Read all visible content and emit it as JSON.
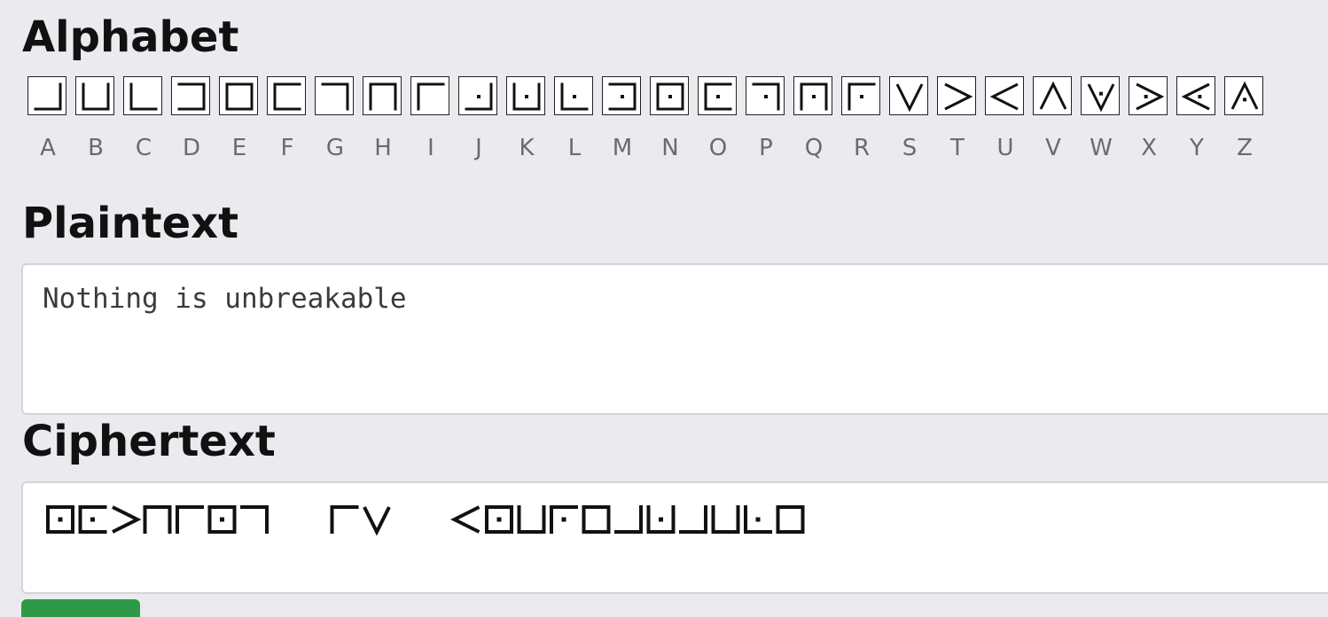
{
  "headings": {
    "alphabet": "Alphabet",
    "plaintext": "Plaintext",
    "ciphertext": "Ciphertext"
  },
  "alphabet": [
    "A",
    "B",
    "C",
    "D",
    "E",
    "F",
    "G",
    "H",
    "I",
    "J",
    "K",
    "L",
    "M",
    "N",
    "O",
    "P",
    "Q",
    "R",
    "S",
    "T",
    "U",
    "V",
    "W",
    "X",
    "Y",
    "Z"
  ],
  "plaintext": {
    "value": "Nothing is unbreakable"
  },
  "ciphertext": {
    "source_text": "Nothing is unbreakable"
  },
  "colors": {
    "background": "#ebebef",
    "glyph_stroke": "#111111",
    "letter_label": "#6b6b6b",
    "button": "#2e9a48"
  }
}
